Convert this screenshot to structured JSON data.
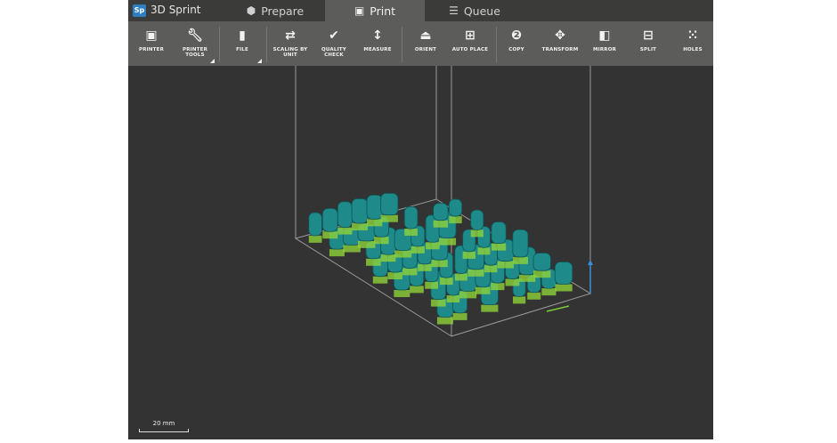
{
  "app": {
    "name": "3D Sprint",
    "logo_text": "Sp"
  },
  "tabs": [
    {
      "label": "Prepare",
      "icon": "cube-icon",
      "active": false
    },
    {
      "label": "Print",
      "icon": "print-cube-icon",
      "active": true
    },
    {
      "label": "Queue",
      "icon": "list-icon",
      "active": false
    }
  ],
  "toolbar": {
    "printer": "PRINTER",
    "printer_tools": "PRINTER TOOLS",
    "file": "FILE",
    "scaling": "SCALING BY UNIT",
    "quality": "QUALITY CHECK",
    "measure": "MEASURE",
    "orient": "ORIENT",
    "auto_place": "AUTO PLACE",
    "copy": "COPY",
    "transform": "TRANSFORM",
    "mirror": "MIRROR",
    "split": "SPLIT",
    "holes": "HOLES"
  },
  "viewport": {
    "scale_label": "20 mm",
    "model_color": "#1f8a8a",
    "support_color": "#8ed13a"
  }
}
